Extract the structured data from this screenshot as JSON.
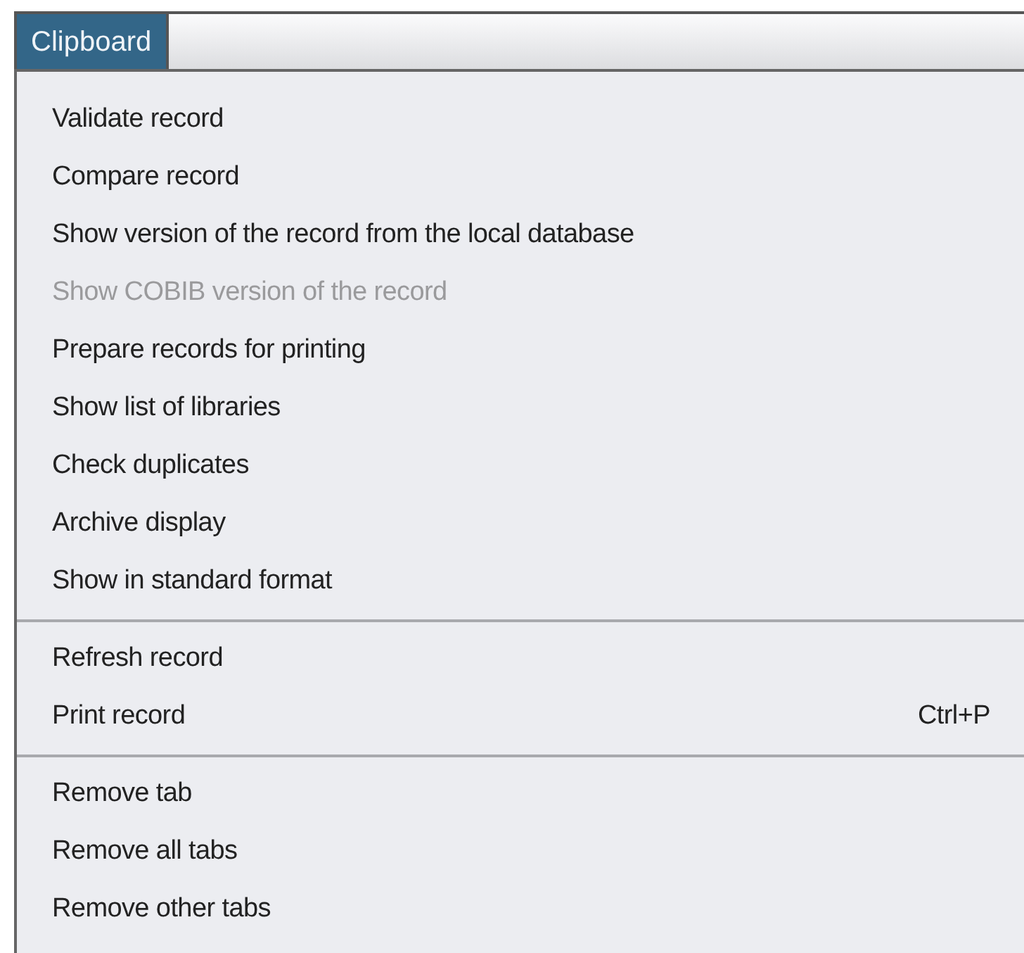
{
  "menu_bar": [
    {
      "label": "Clipboard",
      "selected": true
    }
  ],
  "menu": {
    "sections": [
      [
        {
          "label": "Validate record",
          "disabled": false
        },
        {
          "label": "Compare record",
          "disabled": false
        },
        {
          "label": "Show version of the record from the local database",
          "disabled": false
        },
        {
          "label": "Show COBIB version of the record",
          "disabled": true
        },
        {
          "label": "Prepare records for printing",
          "disabled": false
        },
        {
          "label": "Show list of libraries",
          "disabled": false
        },
        {
          "label": "Check duplicates",
          "disabled": false
        },
        {
          "label": "Archive display",
          "disabled": false
        },
        {
          "label": "Show in standard format",
          "disabled": false
        }
      ],
      [
        {
          "label": "Refresh record",
          "disabled": false
        },
        {
          "label": "Print record",
          "disabled": false,
          "shortcut": "Ctrl+P"
        }
      ],
      [
        {
          "label": "Remove tab",
          "disabled": false
        },
        {
          "label": "Remove all tabs",
          "disabled": false
        },
        {
          "label": "Remove other tabs",
          "disabled": false
        }
      ]
    ]
  }
}
